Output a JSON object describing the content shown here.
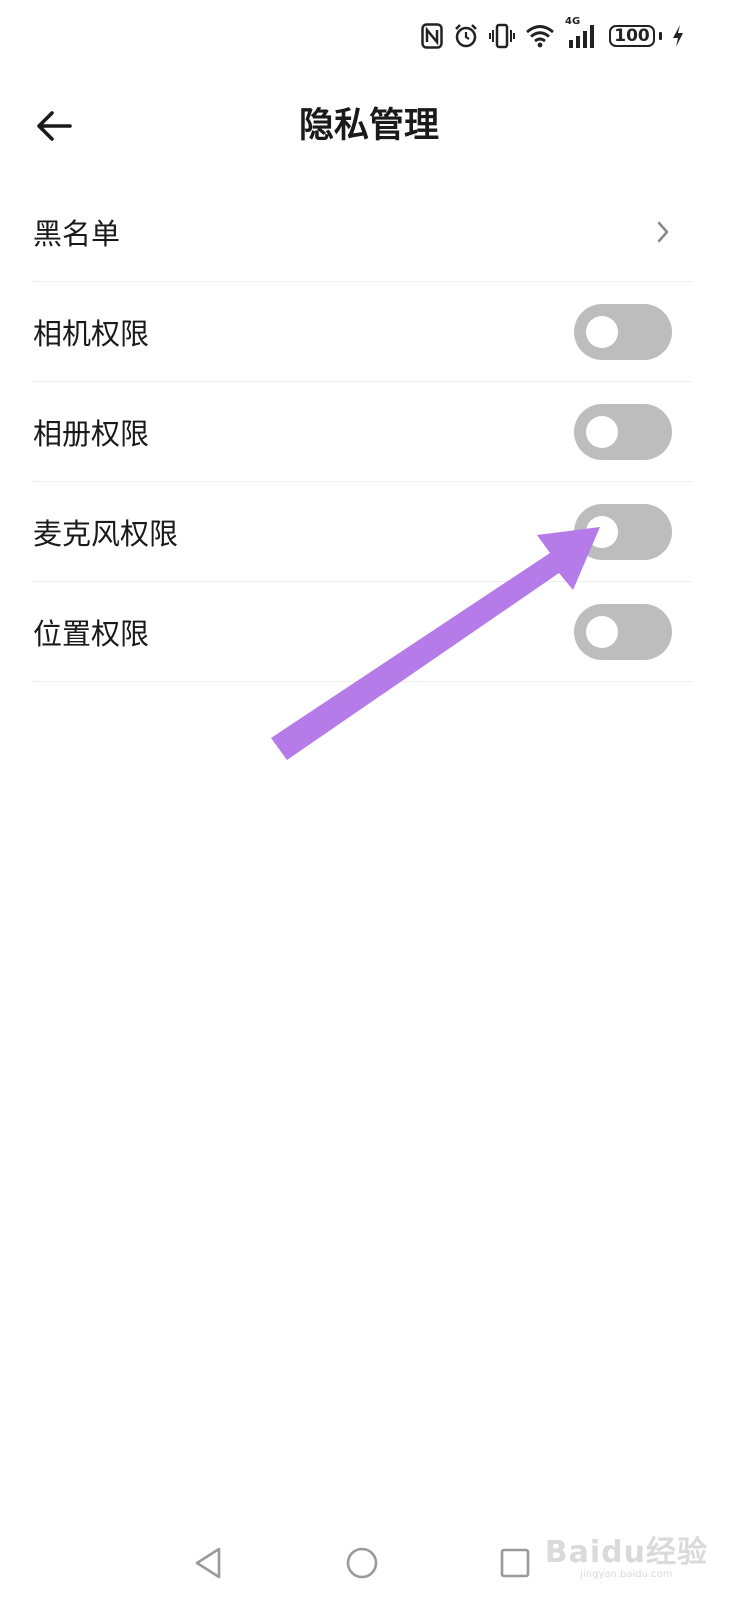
{
  "status_bar": {
    "battery_level": "100",
    "network_label": "4G",
    "icons": [
      "nfc-icon",
      "alarm-icon",
      "vibrate-icon",
      "wifi-icon",
      "signal-icon",
      "battery-icon",
      "charging-icon"
    ]
  },
  "header": {
    "title": "隐私管理",
    "back_icon": "arrow-left-icon"
  },
  "settings": {
    "items": [
      {
        "label": "黑名单",
        "control": "chevron"
      },
      {
        "label": "相机权限",
        "control": "toggle",
        "enabled": false
      },
      {
        "label": "相册权限",
        "control": "toggle",
        "enabled": false
      },
      {
        "label": "麦克风权限",
        "control": "toggle",
        "enabled": false
      },
      {
        "label": "位置权限",
        "control": "toggle",
        "enabled": false
      }
    ]
  },
  "annotation": {
    "color": "#b57be8",
    "points_to": "麦克风权限"
  },
  "nav_bar": {
    "buttons": [
      "back-triangle-icon",
      "home-circle-icon",
      "recents-square-icon"
    ]
  },
  "watermark": {
    "main": "Baidu经验",
    "sub": "jingyan.baidu.com"
  },
  "colors": {
    "toggle_off": "#bdbdbd",
    "divider": "#ededed",
    "text": "#1a1a1a"
  }
}
